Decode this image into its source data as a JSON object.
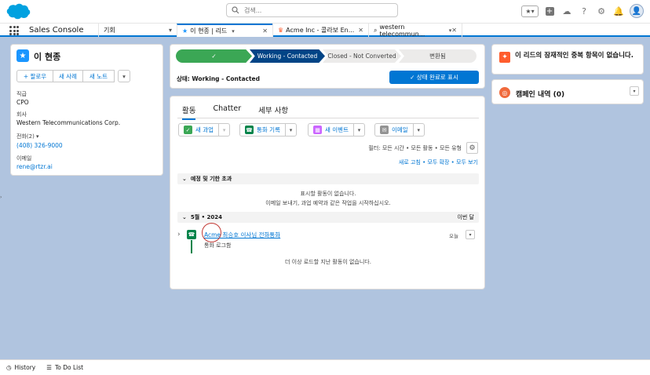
{
  "search": {
    "placeholder": "검색..."
  },
  "nav": {
    "app_name": "Sales Console",
    "object_menu": "기회",
    "tabs": [
      {
        "label": "이 현종 | 리드"
      },
      {
        "label": "Acme Inc - 콜라보 En..."
      },
      {
        "label": "western telecommun..."
      }
    ]
  },
  "lead": {
    "name": "이 현종",
    "buttons": [
      "+ 팔로우",
      "새 사례",
      "새 노트"
    ],
    "title_label": "직급",
    "title_value": "CPO",
    "company_label": "회사",
    "company_value": "Western Telecommunications Corp.",
    "phone_label": "전화(2)",
    "phone_value": "(408) 326-9000",
    "email_label": "이메일",
    "email_value": "rene@rtzr.ai"
  },
  "path": {
    "steps": [
      "✓",
      "Working - Contacted",
      "Closed - Not Converted",
      "변환됨"
    ],
    "status_text": "상태: Working - Contacted",
    "mark_button": "✓ 상태 완료로 표시"
  },
  "activity": {
    "tabs": [
      "활동",
      "Chatter",
      "세부 사항"
    ],
    "actions": [
      {
        "label": "새 과업",
        "color": "#3ba755",
        "glyph": "✓"
      },
      {
        "label": "통화 기록",
        "color": "#04844b",
        "glyph": "☎"
      },
      {
        "label": "새 이벤트",
        "color": "#cb65ff",
        "glyph": "▦"
      },
      {
        "label": "이메일",
        "color": "#939393",
        "glyph": "✉"
      }
    ],
    "filter_text": "필터: 모든 시간 • 모든 활동 • 모든 유형",
    "links": "새로 고침 • 모두 확장 • 모두 보기",
    "upcoming_title": "예정 및 기한 초과",
    "no_activity_1": "표시할 활동이 없습니다.",
    "no_activity_2": "이메일 보내기, 과업 예약과 같은 작업을 시작하십시오.",
    "month_title": "5월 • 2024",
    "month_right": "이번 달",
    "item_title_acme": "Acme",
    "item_title_rest": " 최승호 이사님 전화통화",
    "item_sub": "통화 로그함",
    "item_date": "오늘",
    "no_more": "더 이상 로드할 지난 활동이 없습니다."
  },
  "right": {
    "dup_text": "이 리드의 잠재적인 중복 항목이 없습니다.",
    "campaign_title": "캠페인 내역 (0)"
  },
  "bottom": {
    "history": "History",
    "todo": "To Do List"
  }
}
